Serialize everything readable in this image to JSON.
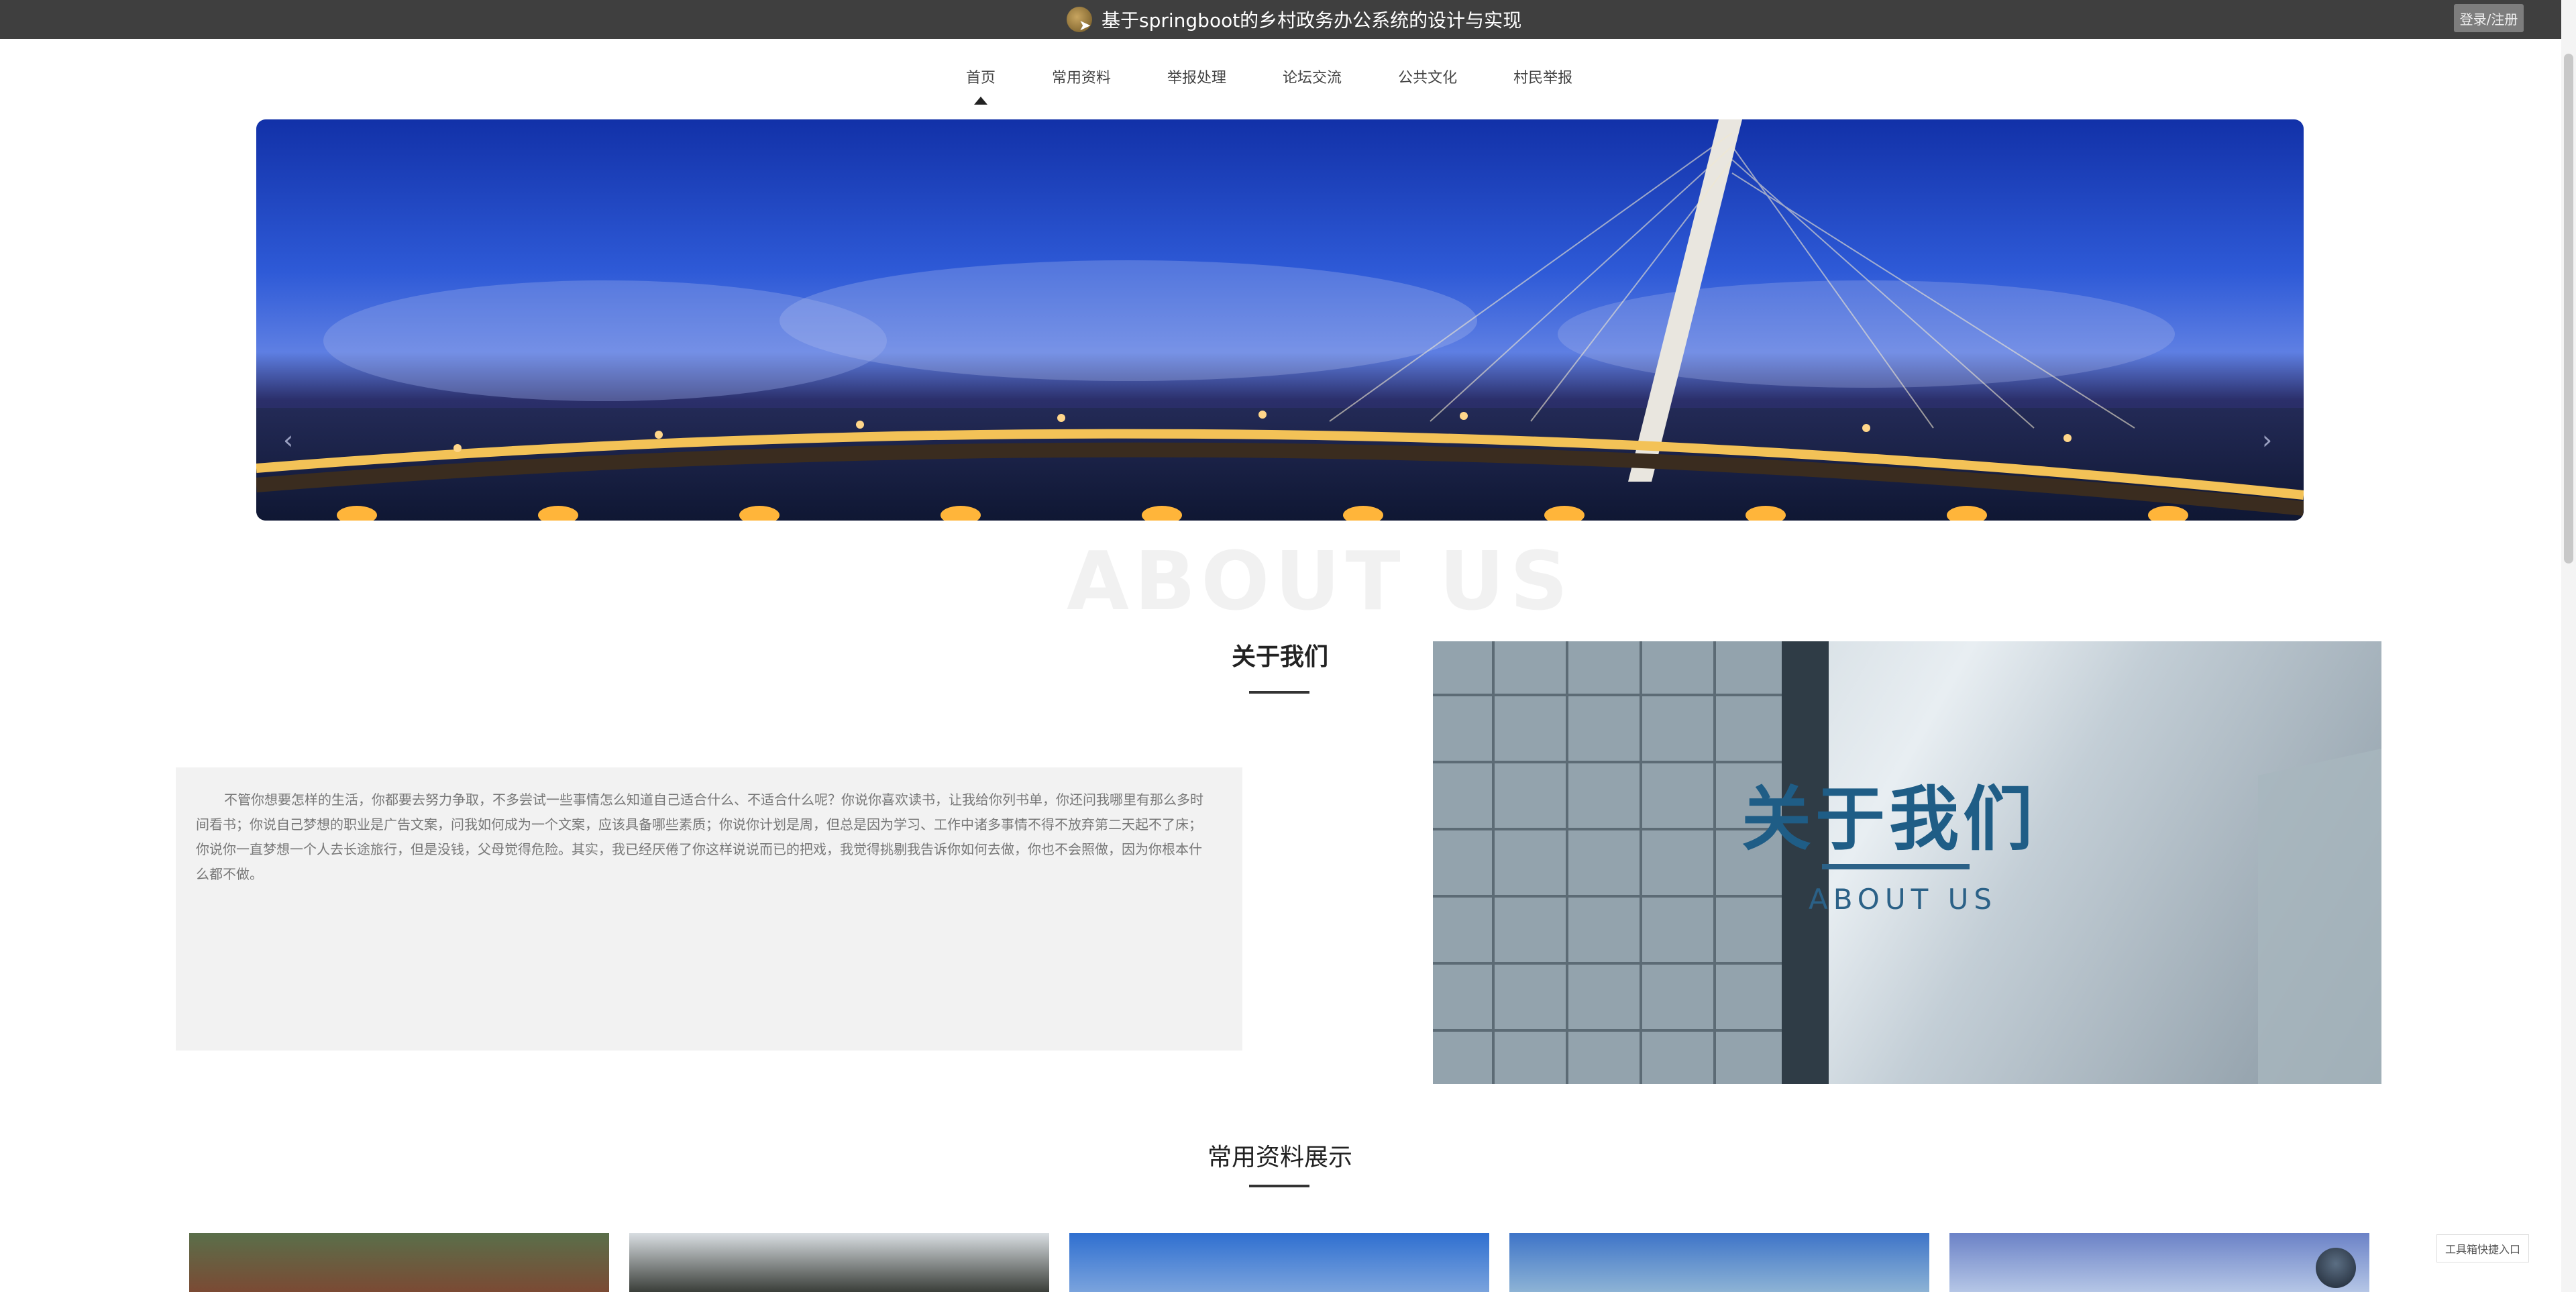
{
  "header": {
    "title": "基于springboot的乡村政务办公系统的设计与实现",
    "login_label": "登录/注册"
  },
  "nav": {
    "items": [
      "首页",
      "常用资料",
      "举报处理",
      "论坛交流",
      "公共文化",
      "村民举报"
    ],
    "active_index": 0
  },
  "banner": {
    "prev_icon": "chevron-left-icon",
    "next_icon": "chevron-right-icon",
    "slide_count": 3,
    "active_slide": 0
  },
  "about": {
    "watermark": "ABOUT US",
    "title": "关于我们",
    "text": "不管你想要怎样的生活，你都要去努力争取，不多尝试一些事情怎么知道自己适合什么、不适合什么呢？你说你喜欢读书，让我给你列书单，你还问我哪里有那么多时间看书；你说自己梦想的职业是广告文案，问我如何成为一个文案，应该具备哪些素质；你说你计划是周，但总是因为学习、工作中诸多事情不得不放弃第二天起不了床；你说你一直梦想一个人去长途旅行，但是没钱，父母觉得危险。其实，我已经厌倦了你这样说说而已的把戏，我觉得挑剔我告诉你如何去做，你也不会照做，因为你根本什么都不做。",
    "image_title": "关于我们",
    "image_subtitle": "ABOUT US"
  },
  "materials": {
    "title": "常用资料展示",
    "thumb_count": 5
  },
  "float_tools": {
    "entry_label": "工具箱快捷入口"
  }
}
